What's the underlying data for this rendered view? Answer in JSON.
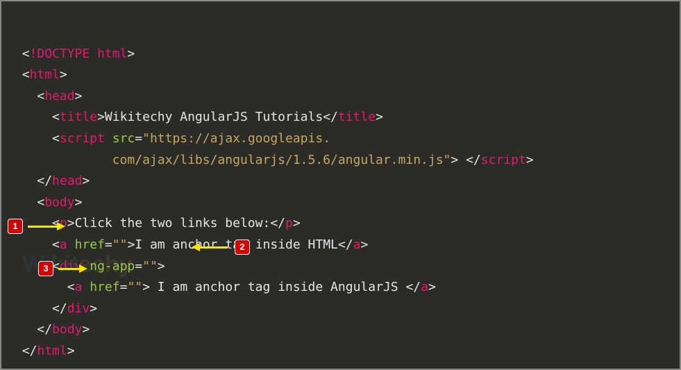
{
  "code": {
    "doctype": "!DOCTYPE html",
    "html_open": "html",
    "head_open": "head",
    "title_open": "title",
    "title_text": "Wikitechy AngularJS Tutorials",
    "title_close": "title",
    "script_open": "script",
    "src_attr": "src",
    "src_val1": "\"https://ajax.googleapis.",
    "src_val2": "com/ajax/libs/angularjs/1.5.6/angular.min.js\"",
    "script_close": "script",
    "head_close": "head",
    "body_open": "body",
    "p_open": "p",
    "p_text": "Click the two links below:",
    "p_close": "p",
    "a1_open": "a",
    "href_attr": "href",
    "href_val": "\"\"",
    "a1_text": "I am anchor tag inside HTML",
    "a1_close": "a",
    "div_open": "div",
    "ngapp_attr": "ng-app",
    "ngapp_val": "\"\"",
    "a2_open": "a",
    "a2_text": " I am anchor tag inside AngularJS ",
    "a2_close": "a",
    "div_close": "div",
    "body_close": "body",
    "html_close": "html"
  },
  "badges": {
    "b1": "1",
    "b2": "2",
    "b3": "3"
  },
  "watermark": "Wikitechy"
}
